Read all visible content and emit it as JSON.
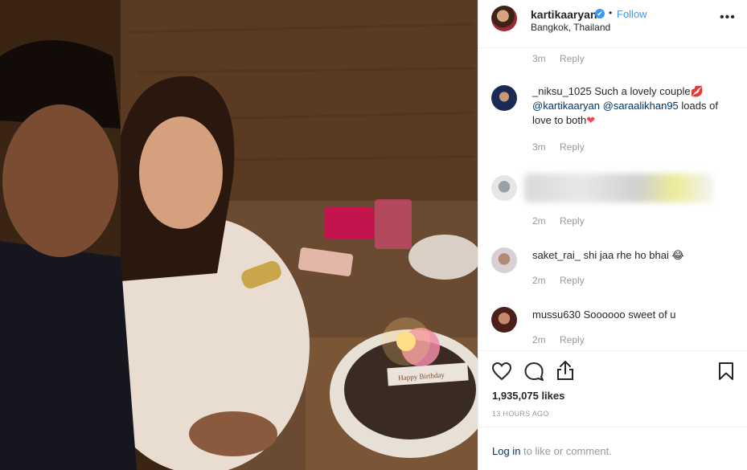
{
  "post": {
    "image_alt": "Selfie of a couple with a birthday cake and lit candle",
    "cake_text": "Happy Birthday"
  },
  "header": {
    "username": "kartikaaryan",
    "verified_mark": "✔",
    "separator": "•",
    "follow_label": "Follow",
    "location": "Bangkok, Thailand",
    "more_label": "•••"
  },
  "comments": [
    {
      "time": "3m",
      "reply_label": "Reply"
    },
    {
      "username": "_niksu_1025",
      "text": "Such a lovely couple",
      "emoji1": "💋",
      "mention1": "@kartikaaryan",
      "mention2": "@saraalikhan95",
      "text2": "loads of love to both",
      "emoji2": "❤",
      "time": "3m",
      "reply_label": "Reply"
    },
    {
      "blurred": true,
      "time": "2m",
      "reply_label": "Reply"
    },
    {
      "username": "saket_rai_",
      "text": "shi jaa rhe ho bhai",
      "emoji": "😂",
      "time": "2m",
      "reply_label": "Reply"
    },
    {
      "username": "mussu630",
      "text": "Soooooo sweet of u",
      "time": "2m",
      "reply_label": "Reply"
    }
  ],
  "actions": {
    "like_icon": "heart-icon",
    "comment_icon": "comment-icon",
    "share_icon": "share-icon",
    "save_icon": "bookmark-icon",
    "likes": "1,935,075 likes",
    "timestamp": "13 HOURS AGO"
  },
  "footer": {
    "login_link": "Log in",
    "login_text": " to like or comment."
  },
  "colors": {
    "accent": "#3897f0",
    "link": "#003569",
    "muted": "#999999",
    "heart": "#ed4956"
  }
}
